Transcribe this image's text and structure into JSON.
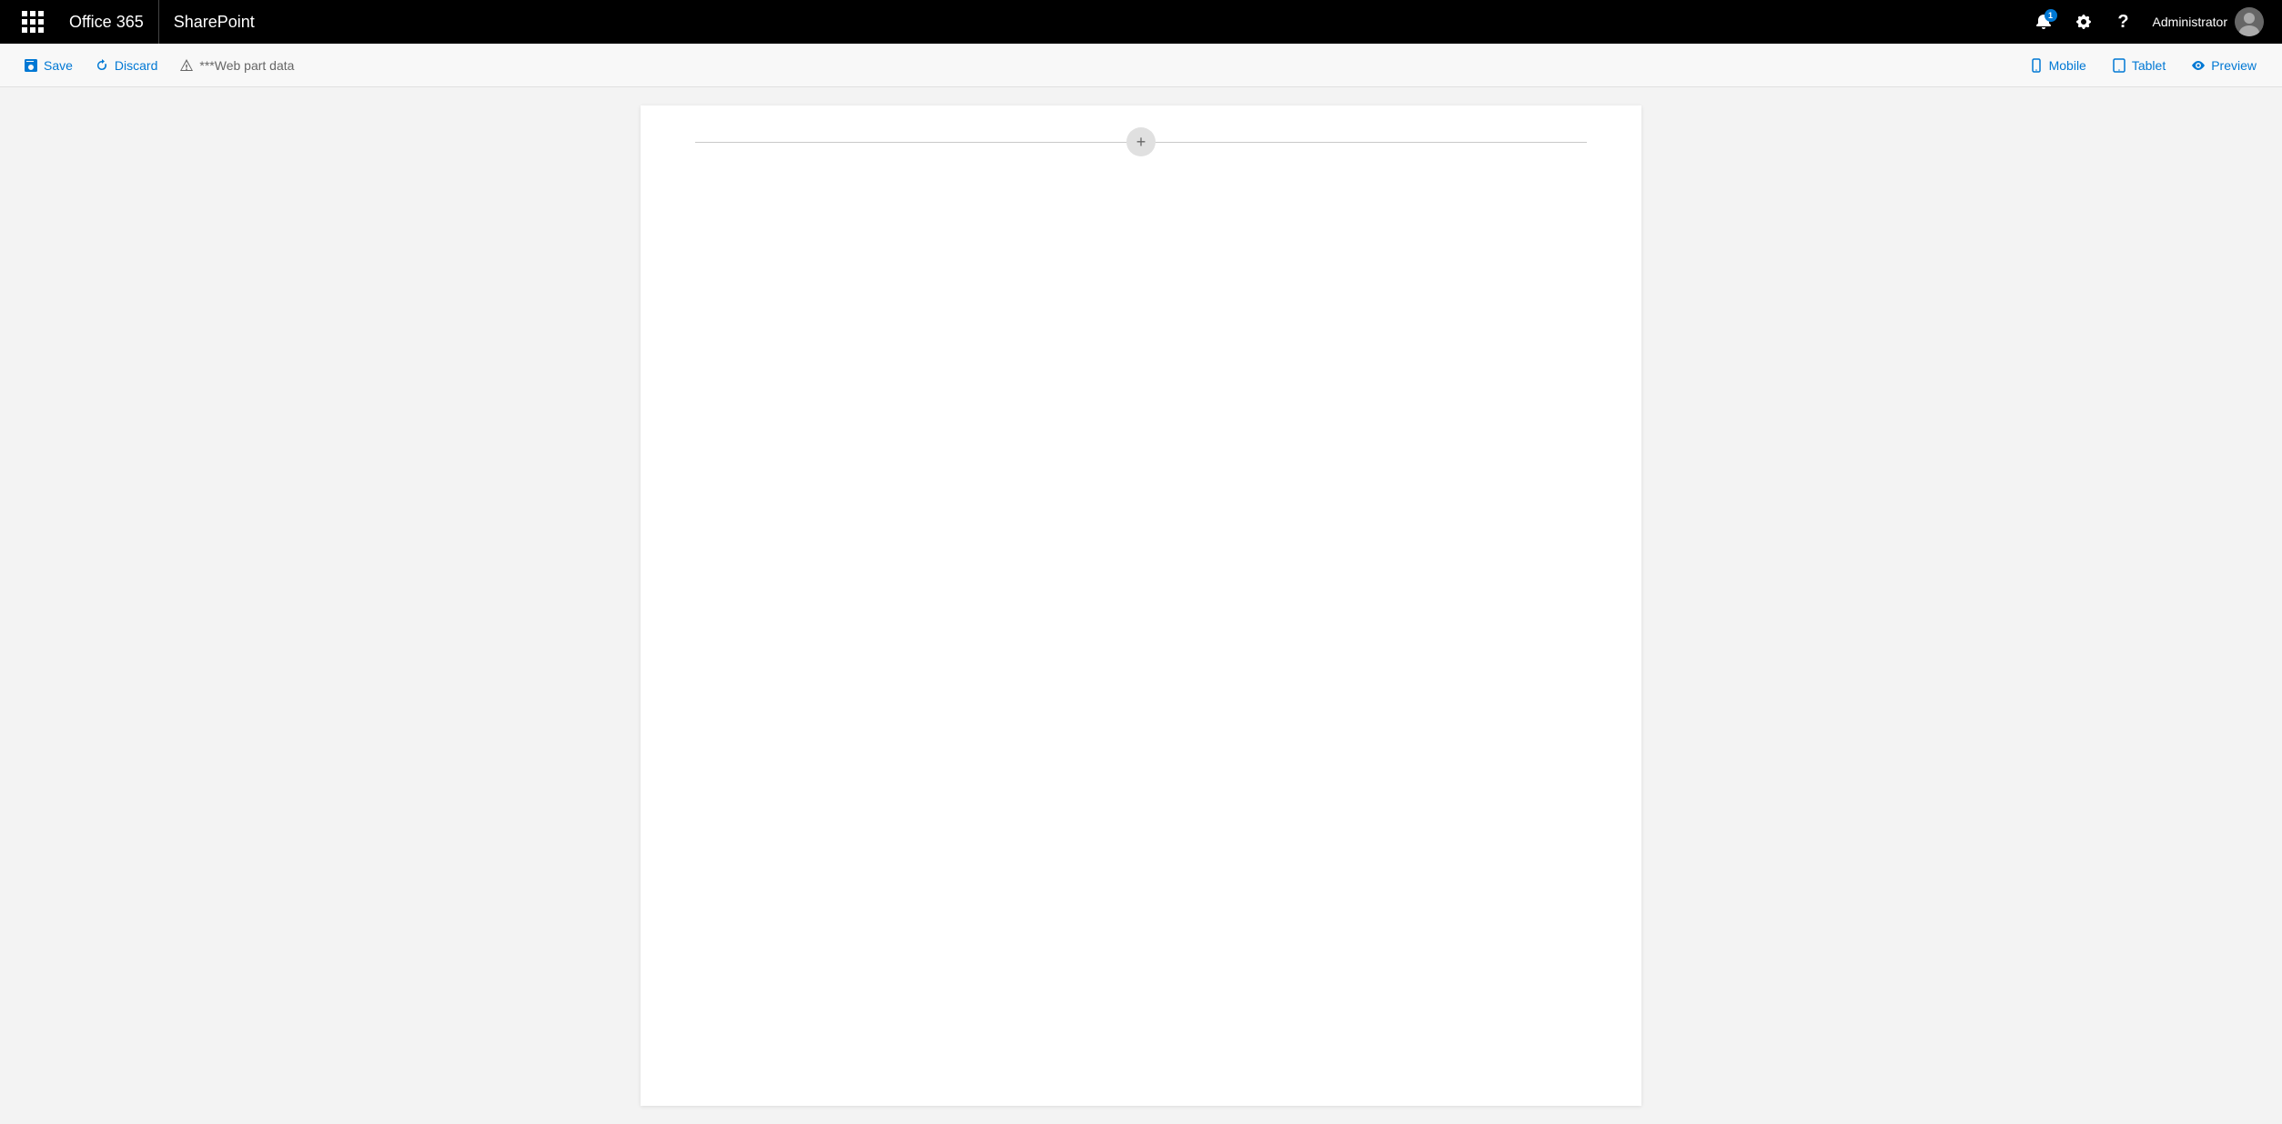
{
  "topNav": {
    "office365Label": "Office 365",
    "sharepointLabel": "SharePoint",
    "notificationCount": "1",
    "userName": "Administrator"
  },
  "toolbar": {
    "saveLabel": "Save",
    "discardLabel": "Discard",
    "warningLabel": "***Web part data",
    "mobileLabel": "Mobile",
    "tabletLabel": "Tablet",
    "previewLabel": "Preview"
  },
  "canvas": {
    "addSectionTooltip": "+"
  }
}
